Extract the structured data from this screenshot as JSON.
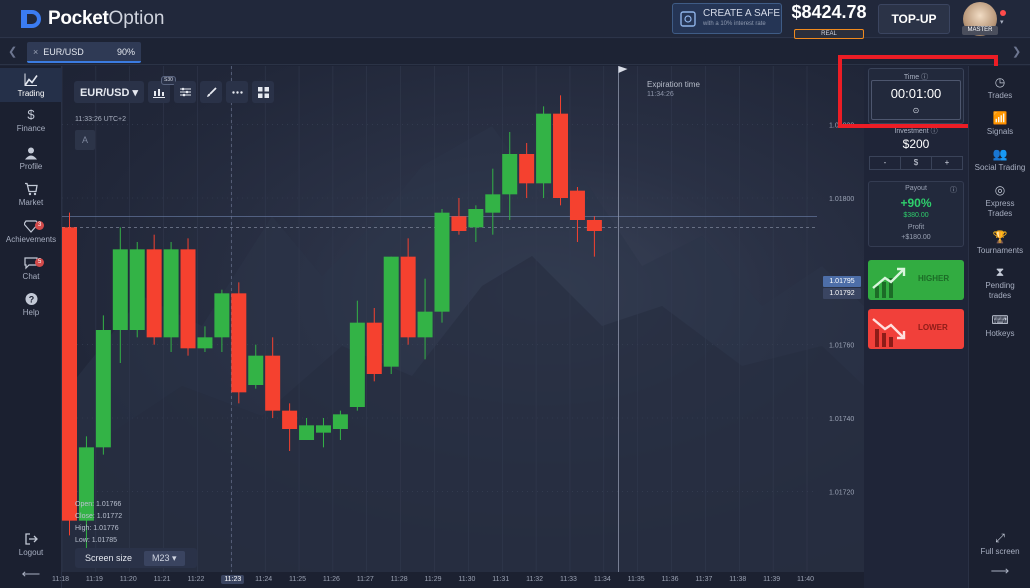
{
  "header": {
    "logo_text_bold": "Pocket",
    "logo_text_light": "Option",
    "safe_button": {
      "title": "CREATE A SAFE",
      "subtitle": "with a 10% interest rate"
    },
    "balance": "$8424.78",
    "balance_mode": "REAL",
    "topup_label": "TOP-UP",
    "avatar_badge": "MASTER"
  },
  "tabs": {
    "prev_icon": "chevron-left-icon",
    "next_icon": "chevron-right-icon",
    "asset_tab": {
      "close": "×",
      "name": "EUR/USD",
      "payout": "90%"
    }
  },
  "left_nav": [
    {
      "label": "Trading",
      "icon": "chart-icon",
      "glyph": "📈"
    },
    {
      "label": "Finance",
      "icon": "dollar-icon",
      "glyph": "$"
    },
    {
      "label": "Profile",
      "icon": "user-icon",
      "glyph": "●"
    },
    {
      "label": "Market",
      "icon": "cart-icon",
      "glyph": "🛒"
    },
    {
      "label": "Achievements",
      "icon": "diamond-icon",
      "glyph": "◇",
      "badge": "3"
    },
    {
      "label": "Chat",
      "icon": "chat-icon",
      "glyph": "💬",
      "badge": "5"
    },
    {
      "label": "Help",
      "icon": "help-icon",
      "glyph": "?"
    }
  ],
  "left_footer": {
    "logout_label": "Logout",
    "back_icon": "arrow-left-icon"
  },
  "chart_toolbar": {
    "pair": "EUR/USD ▾",
    "timeframe_badge": "S30",
    "buttons": [
      "candles-icon",
      "settings-sliders-icon",
      "brush-icon",
      "dots-icon",
      "grid-icon"
    ]
  },
  "chart_meta": {
    "clock": "11:33:26 UTC+2",
    "indicator_letter": "A",
    "expiration_label": "Expiration time",
    "expiration_time": "11:34:26",
    "ohlc": {
      "open": "Open: 1.01766",
      "close": "Close: 1.01772",
      "high": "High: 1.01776",
      "low": "Low: 1.01785"
    },
    "screen_size_label": "Screen size",
    "screen_size_value": "M23 ▾",
    "price_tag_current": "1.01795",
    "price_tag_open": "1.01792"
  },
  "chart_data": {
    "type": "candlestick",
    "y_ticks": [
      1.0182,
      1.018,
      1.0176,
      1.0174,
      1.0172
    ],
    "y_tick_labels": [
      "1.01820",
      "1.01800",
      "1.01760",
      "1.01740",
      "1.01720"
    ],
    "ylim": [
      1.01698,
      1.01836
    ],
    "x_ticks": [
      "11:18",
      "11:19",
      "11:20",
      "11:21",
      "11:22",
      "11:23",
      "11:24",
      "11:25",
      "11:26",
      "11:27",
      "11:28",
      "11:29",
      "11:30",
      "11:31",
      "11:32",
      "11:33",
      "11:34",
      "11:35",
      "11:36",
      "11:37",
      "11:38",
      "11:39",
      "11:40"
    ],
    "current_x_tick": "11:23",
    "expiration_at": "11:34:26",
    "current_price": 1.01795,
    "open_price_line": 1.01792,
    "candles": [
      {
        "t": "11:18:00",
        "o": 1.01792,
        "h": 1.01796,
        "l": 1.01708,
        "c": 1.01712
      },
      {
        "t": "11:18:30",
        "o": 1.01712,
        "h": 1.01735,
        "l": 1.01702,
        "c": 1.01732
      },
      {
        "t": "11:19:00",
        "o": 1.01732,
        "h": 1.01768,
        "l": 1.0173,
        "c": 1.01764
      },
      {
        "t": "11:19:30",
        "o": 1.01764,
        "h": 1.01792,
        "l": 1.01755,
        "c": 1.01786
      },
      {
        "t": "11:20:00",
        "o": 1.01764,
        "h": 1.01788,
        "l": 1.01762,
        "c": 1.01786
      },
      {
        "t": "11:20:30",
        "o": 1.01786,
        "h": 1.0179,
        "l": 1.0176,
        "c": 1.01762
      },
      {
        "t": "11:21:00",
        "o": 1.01762,
        "h": 1.01788,
        "l": 1.01758,
        "c": 1.01786
      },
      {
        "t": "11:21:30",
        "o": 1.01786,
        "h": 1.01789,
        "l": 1.01757,
        "c": 1.01759
      },
      {
        "t": "11:22:00",
        "o": 1.01759,
        "h": 1.01765,
        "l": 1.01758,
        "c": 1.01762
      },
      {
        "t": "11:22:30",
        "o": 1.01762,
        "h": 1.01775,
        "l": 1.01758,
        "c": 1.01774
      },
      {
        "t": "11:23:00",
        "o": 1.01774,
        "h": 1.01777,
        "l": 1.01744,
        "c": 1.01747
      },
      {
        "t": "11:23:30",
        "o": 1.01749,
        "h": 1.0176,
        "l": 1.01748,
        "c": 1.01757
      },
      {
        "t": "11:24:00",
        "o": 1.01757,
        "h": 1.01762,
        "l": 1.0174,
        "c": 1.01742
      },
      {
        "t": "11:24:30",
        "o": 1.01742,
        "h": 1.01744,
        "l": 1.01731,
        "c": 1.01737
      },
      {
        "t": "11:25:00",
        "o": 1.01734,
        "h": 1.0174,
        "l": 1.01734,
        "c": 1.01738
      },
      {
        "t": "11:25:30",
        "o": 1.01736,
        "h": 1.0174,
        "l": 1.01732,
        "c": 1.01738
      },
      {
        "t": "11:26:00",
        "o": 1.01737,
        "h": 1.01742,
        "l": 1.01734,
        "c": 1.01741
      },
      {
        "t": "11:26:30",
        "o": 1.01743,
        "h": 1.01772,
        "l": 1.01742,
        "c": 1.01766
      },
      {
        "t": "11:27:00",
        "o": 1.01766,
        "h": 1.0177,
        "l": 1.0175,
        "c": 1.01752
      },
      {
        "t": "11:27:30",
        "o": 1.01754,
        "h": 1.01784,
        "l": 1.01752,
        "c": 1.01784
      },
      {
        "t": "11:28:00",
        "o": 1.01784,
        "h": 1.01789,
        "l": 1.0176,
        "c": 1.01762
      },
      {
        "t": "11:28:30",
        "o": 1.01762,
        "h": 1.01778,
        "l": 1.01756,
        "c": 1.01769
      },
      {
        "t": "11:29:00",
        "o": 1.01769,
        "h": 1.01797,
        "l": 1.01766,
        "c": 1.01796
      },
      {
        "t": "11:29:30",
        "o": 1.01795,
        "h": 1.018,
        "l": 1.0179,
        "c": 1.01791
      },
      {
        "t": "11:30:00",
        "o": 1.01792,
        "h": 1.01798,
        "l": 1.01788,
        "c": 1.01797
      },
      {
        "t": "11:30:30",
        "o": 1.01796,
        "h": 1.01808,
        "l": 1.0179,
        "c": 1.01801
      },
      {
        "t": "11:31:00",
        "o": 1.01801,
        "h": 1.01818,
        "l": 1.01794,
        "c": 1.01812
      },
      {
        "t": "11:31:30",
        "o": 1.01812,
        "h": 1.01815,
        "l": 1.018,
        "c": 1.01804
      },
      {
        "t": "11:32:00",
        "o": 1.01804,
        "h": 1.01825,
        "l": 1.018,
        "c": 1.01823
      },
      {
        "t": "11:32:30",
        "o": 1.01823,
        "h": 1.01828,
        "l": 1.01798,
        "c": 1.018
      },
      {
        "t": "11:33:00",
        "o": 1.01802,
        "h": 1.01803,
        "l": 1.01788,
        "c": 1.01794
      },
      {
        "t": "11:33:30",
        "o": 1.01794,
        "h": 1.01795,
        "l": 1.01784,
        "c": 1.01791
      }
    ],
    "colors": {
      "up": "#33b346",
      "down": "#f5412f"
    }
  },
  "trade_panel": {
    "time_label": "Time ⓘ",
    "time_value": "00:01:00",
    "time_clock_icon": "⊙",
    "invest_label": "Investment ⓘ",
    "invest_value": "$200",
    "invest_controls": [
      "-",
      "$",
      "+"
    ],
    "payout_label": "Payout",
    "payout_info": "ⓘ",
    "payout_pct": "+90%",
    "payout_amount": "$380.00",
    "profit_label": "Profit",
    "profit_value": "+$180.00",
    "higher_label": "HIGHER",
    "lower_label": "LOWER",
    "colors": {
      "higher": "#32ac41",
      "lower": "#f1403a",
      "highlight": "#ec1d25"
    }
  },
  "right_nav": [
    {
      "label": "Trades",
      "icon": "clock-icon",
      "glyph": "◷"
    },
    {
      "label": "Signals",
      "icon": "signal-icon",
      "glyph": "📶"
    },
    {
      "label": "Social Trading",
      "icon": "people-icon",
      "glyph": "👥"
    },
    {
      "label": "Express Trades",
      "icon": "target-icon",
      "glyph": "◎"
    },
    {
      "label": "Tournaments",
      "icon": "trophy-icon",
      "glyph": "🏆"
    },
    {
      "label": "Pending trades",
      "icon": "hourglass-icon",
      "glyph": "⧗"
    },
    {
      "label": "Hotkeys",
      "icon": "keyboard-icon",
      "glyph": "⌨"
    }
  ],
  "right_footer": {
    "fullscreen_label": "Full screen",
    "next_icon": "arrow-right-icon"
  }
}
